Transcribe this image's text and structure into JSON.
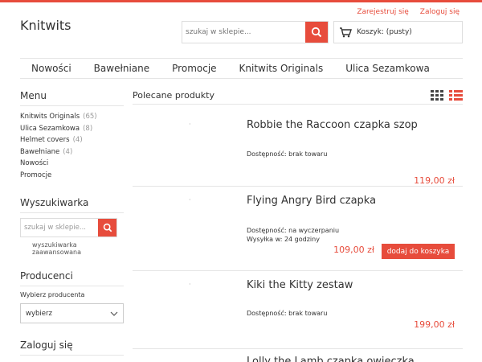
{
  "header": {
    "links": {
      "register": "Zarejestruj się",
      "login": "Zaloguj się"
    },
    "logo": "Knitwits",
    "search_placeholder": "szukaj w sklepie...",
    "cart_label": "Koszyk: (pusty)"
  },
  "nav": [
    "Nowości",
    "Bawełniane",
    "Promocje",
    "Knitwits Originals",
    "Ulica Sezamkowa"
  ],
  "sidebar": {
    "menu_title": "Menu",
    "menu_items": [
      {
        "label": "Knitwits Originals",
        "count": "(65)"
      },
      {
        "label": "Ulica Sezamkowa",
        "count": "(8)"
      },
      {
        "label": "Helmet covers",
        "count": "(4)"
      },
      {
        "label": "Bawełniane",
        "count": "(4)"
      },
      {
        "label": "Nowości",
        "count": ""
      },
      {
        "label": "Promocje",
        "count": ""
      }
    ],
    "search_title": "Wyszukiwarka",
    "search_placeholder": "szukaj w sklepie...",
    "advanced_link": "wyszukiwarka zaawansowana",
    "producers_title": "Producenci",
    "producers_label": "Wybierz producenta",
    "producers_selected": "wybierz",
    "login_title": "Zaloguj się"
  },
  "main": {
    "title": "Polecane produkty",
    "products": [
      {
        "name": "Robbie the Raccoon czapka szop",
        "availability": "Dostępność: brak towaru",
        "shipping": "",
        "price": "119,00 zł",
        "add_to_cart": ""
      },
      {
        "name": "Flying Angry Bird czapka",
        "availability": "Dostępność: na wyczerpaniu",
        "shipping": "Wysyłka w: 24 godziny",
        "price": "109,00 zł",
        "add_to_cart": "dodaj do koszyka"
      },
      {
        "name": "Kiki the Kitty zestaw",
        "availability": "Dostępność: brak towaru",
        "shipping": "",
        "price": "199,00 zł",
        "add_to_cart": ""
      },
      {
        "name": "Lolly the Lamb czapka owieczka",
        "availability": "",
        "shipping": "",
        "price": "",
        "add_to_cart": ""
      }
    ]
  },
  "colors": {
    "accent": "#e74c3c"
  }
}
